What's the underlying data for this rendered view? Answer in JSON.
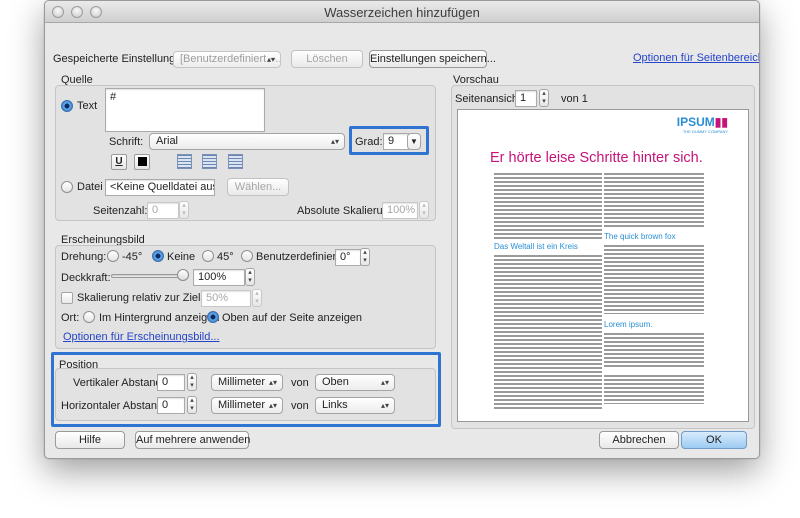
{
  "window": {
    "title": "Wasserzeichen hinzufügen"
  },
  "top": {
    "saved_settings_label": "Gespeicherte Einstellungen:",
    "saved_settings_value": "[Benutzerdefiniert –...",
    "delete_label": "Löschen",
    "save_settings_label": "Einstellungen speichern...",
    "page_range_link": "Optionen für Seitenbereich..."
  },
  "source": {
    "section_title": "Quelle",
    "text_option": "Text",
    "text_value": "#",
    "font_label": "Schrift:",
    "font_value": "Arial",
    "size_label": "Grad:",
    "size_value": "9",
    "underline_symbol": "U",
    "file_option": "Datei",
    "file_value": "<Keine Quelldatei ausgewä",
    "choose_label": "Wählen...",
    "page_number_label": "Seitenzahl:",
    "page_number_value": "0",
    "absolute_scale_label": "Absolute Skalierung:",
    "absolute_scale_value": "100%"
  },
  "appearance": {
    "section_title": "Erscheinungsbild",
    "rotation_label": "Drehung:",
    "rotation_options": [
      "-45°",
      "Keine",
      "45°",
      "Benutzerdefiniert"
    ],
    "rotation_custom_value": "0°",
    "opacity_label": "Deckkraft:",
    "opacity_value": "100%",
    "opacity_fraction": 1.0,
    "scale_relative_label": "Skalierung relativ zur Zielseite",
    "scale_relative_value": "50%",
    "location_label": "Ort:",
    "location_options": [
      "Im Hintergrund anzeigen",
      "Oben auf der Seite anzeigen"
    ],
    "appearance_options_link": "Optionen für Erscheinungsbild..."
  },
  "position": {
    "section_title": "Position",
    "vertical_label": "Vertikaler Abstand:",
    "vertical_value": "0",
    "vertical_unit": "Millimeter",
    "vertical_from_label": "von",
    "vertical_anchor": "Oben",
    "horizontal_label": "Horizontaler Abstand:",
    "horizontal_value": "0",
    "horizontal_unit": "Millimeter",
    "horizontal_from_label": "von",
    "horizontal_anchor": "Links"
  },
  "preview": {
    "section_title": "Vorschau",
    "page_view_label": "Seitenansicht",
    "page_value": "1",
    "of_label": "von 1",
    "doc_logo": "IPSUM",
    "doc_logo_sub": "THE DUMMY COMPANY",
    "doc_headline": "Er hörte leise Schritte hinter sich.",
    "doc_subhead_1": "Das Weltall ist ein Kreis",
    "doc_subhead_2": "The quick brown fox",
    "doc_subhead_3": "Lorem ipsum."
  },
  "footer": {
    "help_label": "Hilfe",
    "apply_multiple_label": "Auf mehrere anwenden",
    "cancel_label": "Abbrechen",
    "ok_label": "OK"
  },
  "colors": {
    "highlight": "#2f74d0",
    "link": "#2545c9",
    "doc_pink": "#c6137b",
    "doc_blue": "#2a8ed4"
  }
}
